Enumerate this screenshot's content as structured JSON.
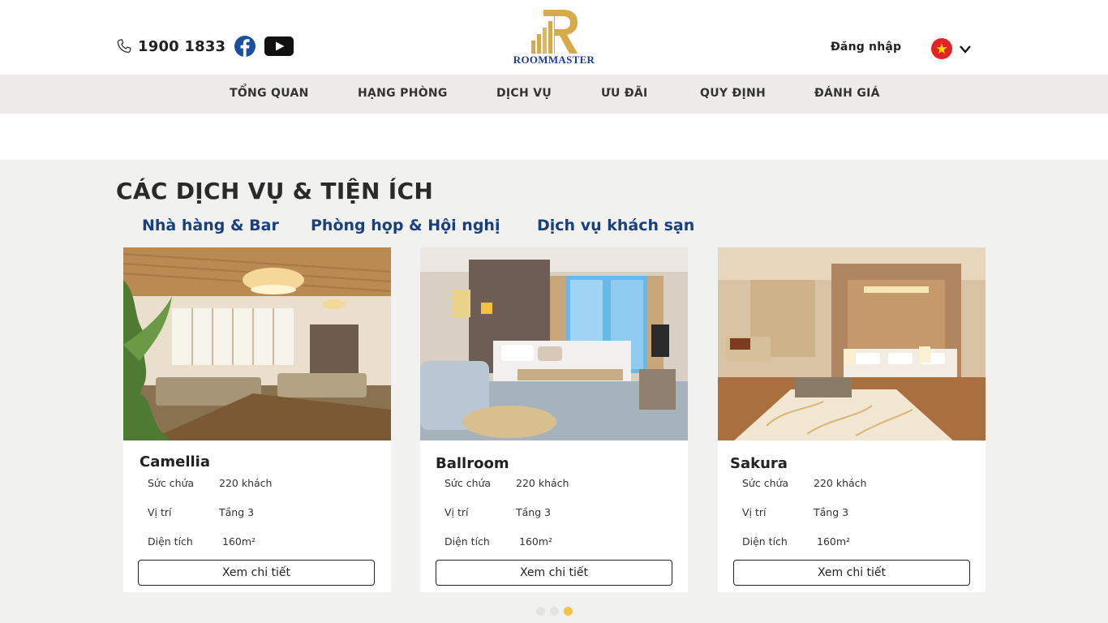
{
  "header": {
    "hotline": "1900 1833",
    "logo_text": "ROOMMASTER",
    "login_label": "Đăng nhập",
    "language": "vi"
  },
  "nav": {
    "items": [
      {
        "label": "TỔNG QUAN"
      },
      {
        "label": "HẠNG PHÒNG"
      },
      {
        "label": "DỊCH VỤ"
      },
      {
        "label": "ƯU ĐÃI"
      },
      {
        "label": "QUY ĐỊNH"
      },
      {
        "label": "ĐÁNH GIÁ"
      }
    ]
  },
  "section": {
    "title": "CÁC DỊCH VỤ & TIỆN ÍCH",
    "tabs": [
      {
        "label": "Nhà hàng & Bar"
      },
      {
        "label": "Phòng họp & Hội nghị"
      },
      {
        "label": "Dịch vụ khách sạn"
      }
    ]
  },
  "cards": [
    {
      "name": "Camellia",
      "specs": [
        {
          "label": "Sức chứa",
          "value": "220 khách"
        },
        {
          "label": "Vị trí",
          "value": "Tầng 3"
        },
        {
          "label": "Diện tích",
          "value": "160m²"
        }
      ],
      "button": "Xem chi tiết",
      "image": "hotel-lounge-photo"
    },
    {
      "name": "Ballroom",
      "specs": [
        {
          "label": "Sức chứa",
          "value": "220 khách"
        },
        {
          "label": "Vị trí",
          "value": "Tầng 3"
        },
        {
          "label": "Diện tích",
          "value": "160m²"
        }
      ],
      "button": "Xem chi tiết",
      "image": "hotel-bedroom-photo"
    },
    {
      "name": "Sakura",
      "specs": [
        {
          "label": "Sức chứa",
          "value": "220 khách"
        },
        {
          "label": "Vị trí",
          "value": "Tầng 3"
        },
        {
          "label": "Diện tích",
          "value": "160m²"
        }
      ],
      "button": "Xem chi tiết",
      "image": "hotel-suite-photo"
    }
  ],
  "carousel": {
    "total": 3,
    "active_index": 2
  },
  "colors": {
    "brand_blue": "#1a3f7c",
    "brand_gold": "#d6aa4a",
    "nav_bg": "#ecebe9",
    "section_bg": "#f1f1f0",
    "dot_active": "#f0c349"
  }
}
